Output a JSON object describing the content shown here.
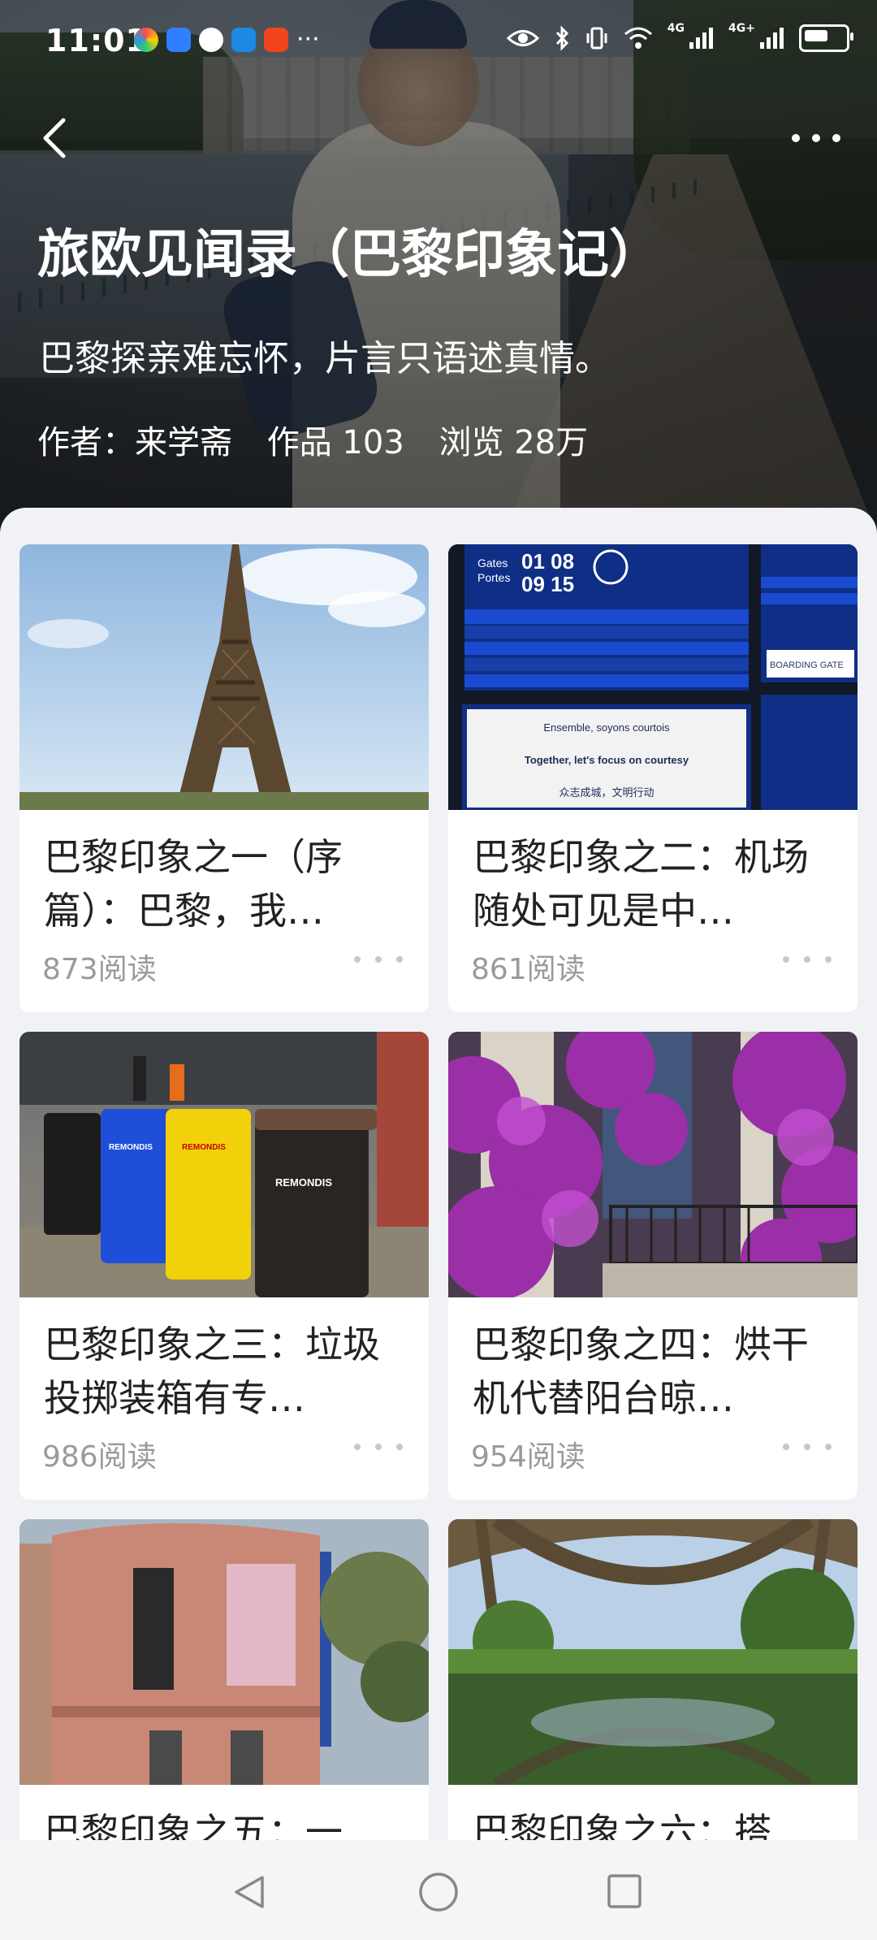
{
  "status_bar": {
    "time": "11:01",
    "network_1": "4G",
    "network_2": "4G+",
    "icons": [
      "app-icons",
      "eye-icon",
      "bluetooth-icon",
      "vibrate-icon",
      "wifi-icon",
      "signal-icon",
      "battery-icon"
    ]
  },
  "header": {
    "title": "旅欧见闻录（巴黎印象记）",
    "subtitle": "巴黎探亲难忘怀，片言只语述真情。",
    "author_label": "作者：来学斋",
    "works_label": "作品 103",
    "views_label": "浏览 28万"
  },
  "articles": [
    {
      "title": "巴黎印象之一（序篇）：巴黎，我…",
      "reads": "873阅读"
    },
    {
      "title": "巴黎印象之二：机场随处可见是中…",
      "reads": "861阅读"
    },
    {
      "title": "巴黎印象之三：垃圾投掷装箱有专…",
      "reads": "986阅读"
    },
    {
      "title": "巴黎印象之四：烘干机代替阳台晾…",
      "reads": "954阅读"
    },
    {
      "title": "巴黎印象之五：一",
      "reads": ""
    },
    {
      "title": "巴黎印象之六：搭",
      "reads": ""
    }
  ],
  "thumbnail_text": {
    "gates": "Gates",
    "portes": "Portes",
    "time1": "01 08",
    "time2": "09 15",
    "notice_title": "Ensemble, soyons courtois",
    "notice_en": "Together, let's focus on courtesy",
    "notice_cn": "众志成城，文明行动",
    "boarding": "BOARDING GATE",
    "bin_brand": "REMONDIS"
  },
  "colors": {
    "page_bg": "#f1f2f5",
    "card_bg": "#ffffff",
    "title_text": "#222222",
    "meta_text": "#9a9a9a"
  }
}
